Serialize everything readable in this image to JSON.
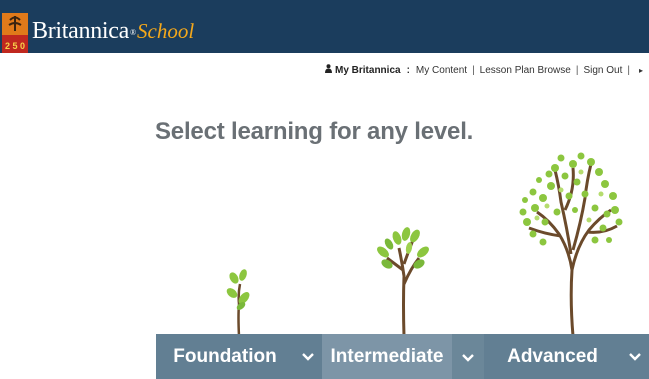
{
  "header": {
    "brand": "Britannica",
    "brand_mark": "®",
    "product": "School",
    "badge_text": "2 5 0",
    "bg_color": "#1b3d5d"
  },
  "user_nav": {
    "my_britannica": "My Britannica",
    "separator_colon": ":",
    "links": [
      "My Content",
      "Lesson Plan Browse",
      "Sign Out"
    ],
    "arrow": "▸"
  },
  "headline": "Select learning for any level.",
  "levels": [
    {
      "label": "Foundation",
      "icon": "chevron-down-icon"
    },
    {
      "label": "Intermediate",
      "icon": "chevron-down-icon"
    },
    {
      "label": "Advanced",
      "icon": "chevron-down-icon"
    }
  ],
  "colors": {
    "tab_bar": "#627f93",
    "tab_active": "#7d95a7",
    "leaf_green": "#8cc63f",
    "trunk_brown": "#6b4a2b"
  }
}
